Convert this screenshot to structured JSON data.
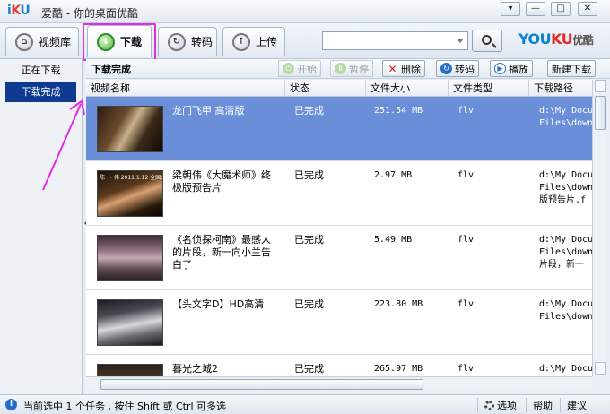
{
  "window": {
    "logo": {
      "i": "i",
      "k": "K",
      "u": "U"
    },
    "app_name": "爱酷",
    "title": "你的桌面优酷",
    "separator": "-",
    "controls": {
      "menu": "▾",
      "minimize": "—",
      "maximize": "□",
      "close": "✕"
    }
  },
  "tabs": [
    {
      "label": "视频库",
      "icon": "home-icon"
    },
    {
      "label": "下载",
      "icon": "download-icon"
    },
    {
      "label": "转码",
      "icon": "transcode-icon"
    },
    {
      "label": "上传",
      "icon": "upload-icon"
    }
  ],
  "search": {
    "value": "",
    "placeholder": ""
  },
  "brand": {
    "you": "YOU",
    "ku": "KU",
    "cn": "优酷"
  },
  "sidebar": {
    "items": [
      {
        "label": "正在下载"
      },
      {
        "label": "下载完成"
      }
    ]
  },
  "main": {
    "title": "下载完成",
    "actions": {
      "start": "开始",
      "pause": "暂停",
      "delete": "删除",
      "transcode": "转码",
      "play": "播放",
      "new_download": "新建下载"
    },
    "columns": [
      "视频名称",
      "状态",
      "文件大小",
      "文件类型",
      "下载路径"
    ]
  },
  "rows": [
    {
      "name": "龙门飞甲 高清版",
      "status": "已完成",
      "size": "251.54 MB",
      "type": "flv",
      "path": "d:\\My Docu\nFiles\\down",
      "thumb_caption": ""
    },
    {
      "name": "梁朝伟《大魔术师》终极版预告片",
      "status": "已完成",
      "size": "2.97 MB",
      "type": "flv",
      "path": "d:\\My Docu\nFiles\\down\n版预告片.f",
      "thumb_caption": "陈 卜 伟 2011.1.12 全国大"
    },
    {
      "name": "《名侦探柯南》最感人的片段，新一向小兰告白了",
      "status": "已完成",
      "size": "5.49 MB",
      "type": "flv",
      "path": "d:\\My Docu\nFiles\\down\n片段，新一",
      "thumb_caption": ""
    },
    {
      "name": "【头文字D】HD高清",
      "status": "已完成",
      "size": "223.80 MB",
      "type": "flv",
      "path": "d:\\My Docu\nFiles\\down",
      "thumb_caption": ""
    },
    {
      "name": "暮光之城2",
      "status": "已完成",
      "size": "265.97 MB",
      "type": "flv",
      "path": "d:\\My Docu",
      "thumb_caption": ""
    }
  ],
  "statusbar": {
    "text": "当前选中 1 个任务 , 按住 Shift 或 Ctrl 可多选",
    "options": "选项",
    "help": "帮助",
    "suggest": "建议"
  },
  "colors": {
    "accent": "#0e3b8f",
    "selected_row": "#6a8fd8",
    "annotation": "#e02ee0"
  }
}
